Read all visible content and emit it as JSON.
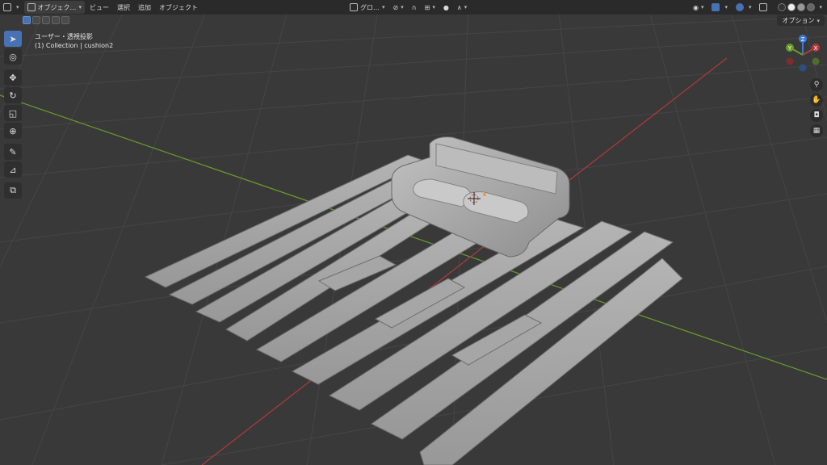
{
  "header": {
    "mode_label": "オブジェク…",
    "menus": [
      "ビュー",
      "選択",
      "追加",
      "オブジェクト"
    ],
    "transform_orientation": "グロ…"
  },
  "options_label": "オプション",
  "viewport_info": {
    "view_name": "ユーザー・透視投影",
    "collection_line": "(1) Collection | cushion2"
  },
  "gizmo": {
    "z": "Z",
    "y": "Y",
    "x": "X"
  },
  "tools": [
    "select-box",
    "cursor",
    "move",
    "rotate",
    "scale",
    "transform",
    "annotate",
    "measure",
    "add-cube"
  ],
  "nav_buttons": [
    "zoom",
    "pan",
    "camera",
    "ortho-toggle"
  ],
  "colors": {
    "accent": "#4772b3",
    "x_axis": "#b33a3a",
    "y_axis": "#6a9c2a",
    "z_axis": "#3b7ad9"
  }
}
